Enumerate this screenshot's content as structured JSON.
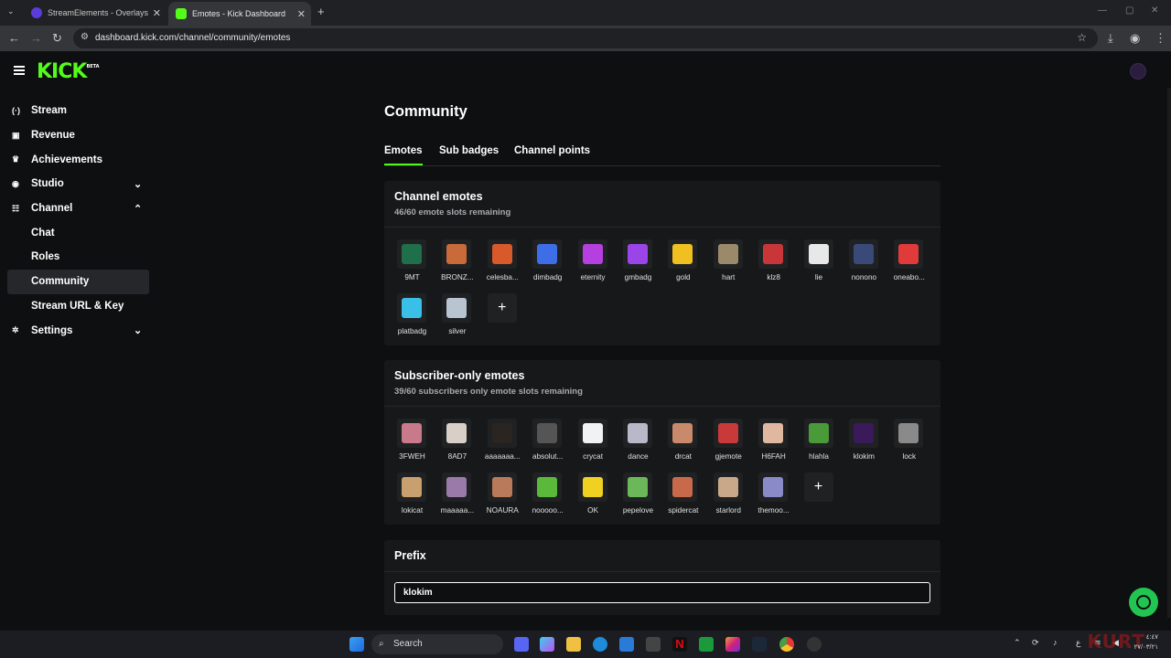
{
  "browser": {
    "tabs": [
      {
        "title": "StreamElements - Overlays",
        "color": "#5b3bdc"
      },
      {
        "title": "Emotes - Kick Dashboard",
        "color": "#53fc18"
      }
    ],
    "new_tab": "+",
    "url": "dashboard.kick.com/channel/community/emotes",
    "icons": {
      "back": "back-icon",
      "forward": "forward-icon",
      "reload": "reload-icon",
      "star": "star-icon",
      "download": "download-icon",
      "profile": "profile-icon",
      "menu": "menu-icon"
    }
  },
  "brand": {
    "logo": "KICK",
    "badge": "BETA",
    "accent": "#53fc18"
  },
  "sidebar": {
    "items": [
      {
        "label": "Stream",
        "icon": "broadcast-icon",
        "glyph": "(·)"
      },
      {
        "label": "Revenue",
        "icon": "revenue-icon",
        "glyph": "▣"
      },
      {
        "label": "Achievements",
        "icon": "trophy-icon",
        "glyph": "♛"
      },
      {
        "label": "Studio",
        "icon": "studio-icon",
        "glyph": "◉",
        "chevron": "⌄"
      },
      {
        "label": "Channel",
        "icon": "channel-icon",
        "glyph": "☷",
        "chevron": "⌃"
      },
      {
        "label": "Chat"
      },
      {
        "label": "Roles"
      },
      {
        "label": "Community",
        "active": true
      },
      {
        "label": "Stream URL & Key"
      },
      {
        "label": "Settings",
        "icon": "gear-icon",
        "glyph": "✲",
        "chevron": "⌄"
      }
    ]
  },
  "main": {
    "title": "Community",
    "tabs": [
      "Emotes",
      "Sub badges",
      "Channel points"
    ],
    "channel_emotes": {
      "title": "Channel emotes",
      "subtitle": "46/60 emote slots remaining",
      "emotes": [
        {
          "name": "9MT",
          "color": "#1f6f4a"
        },
        {
          "name": "BRONZ...",
          "color": "#c96a3a"
        },
        {
          "name": "celesba...",
          "color": "#d85a2a"
        },
        {
          "name": "dimbadg",
          "color": "#3d6ee8"
        },
        {
          "name": "eternity",
          "color": "#b63fe0"
        },
        {
          "name": "gmbadg",
          "color": "#9b45e8"
        },
        {
          "name": "gold",
          "color": "#f0c020"
        },
        {
          "name": "hart",
          "color": "#9b8a6a"
        },
        {
          "name": "klz8",
          "color": "#c9363a"
        },
        {
          "name": "lie",
          "color": "#e8e8e8"
        },
        {
          "name": "nonono",
          "color": "#3a4a78"
        },
        {
          "name": "oneabo...",
          "color": "#e03a3a"
        },
        {
          "name": "platbadg",
          "color": "#3ac0e8"
        },
        {
          "name": "silver",
          "color": "#b8c4d0"
        }
      ],
      "add": "+"
    },
    "sub_emotes": {
      "title": "Subscriber-only emotes",
      "subtitle": "39/60 subscribers only emote slots remaining",
      "emotes": [
        {
          "name": "3FWEH",
          "color": "#c97a8a"
        },
        {
          "name": "8AD7",
          "color": "#d8d0c8"
        },
        {
          "name": "aaaaaaa...",
          "color": "#2a2520"
        },
        {
          "name": "absolut...",
          "color": "#555555"
        },
        {
          "name": "crycat",
          "color": "#f2f2f2"
        },
        {
          "name": "dance",
          "color": "#b8b8c8"
        },
        {
          "name": "drcat",
          "color": "#c88a6a"
        },
        {
          "name": "gjemote",
          "color": "#c83a3a"
        },
        {
          "name": "H6FAH",
          "color": "#e0b8a0"
        },
        {
          "name": "hlahla",
          "color": "#4a9a3a"
        },
        {
          "name": "klokim",
          "color": "#3a1a5a"
        },
        {
          "name": "lock",
          "color": "#8a8a8a"
        },
        {
          "name": "lokicat",
          "color": "#c8a070"
        },
        {
          "name": "maaaaa...",
          "color": "#9a7aa8"
        },
        {
          "name": "NOAURA",
          "color": "#b87a5a"
        },
        {
          "name": "nooooo...",
          "color": "#5ab83a"
        },
        {
          "name": "OK",
          "color": "#f0d020"
        },
        {
          "name": "pepelove",
          "color": "#6ab85a"
        },
        {
          "name": "spidercat",
          "color": "#c86a4a"
        },
        {
          "name": "starlord",
          "color": "#c8a888"
        },
        {
          "name": "themoo...",
          "color": "#8a8ac8"
        }
      ],
      "add": "+"
    },
    "prefix": {
      "title": "Prefix",
      "value": "klokim"
    }
  },
  "taskbar": {
    "search_label": "Search",
    "clock_time": "٤:٤٧",
    "clock_date": "٢٧/٠٣/٢١",
    "lang": "ع",
    "watermark": "KURT"
  }
}
